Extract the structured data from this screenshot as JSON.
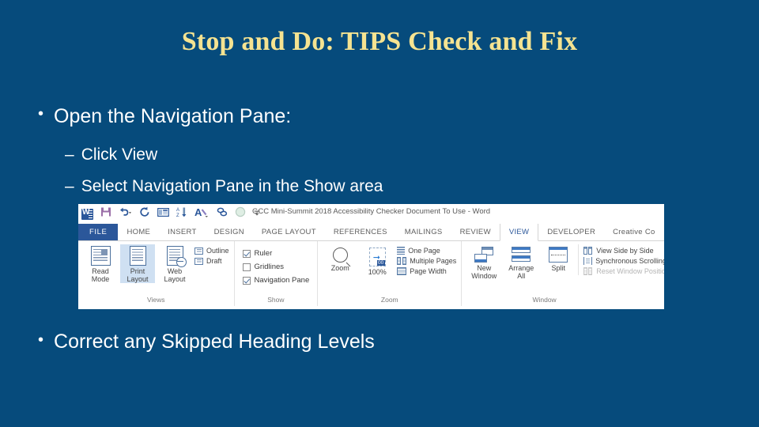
{
  "slide": {
    "title": "Stop and Do: TIPS Check and Fix",
    "bullet_1": "Open the Navigation Pane:",
    "sub_bullets": [
      "Click View",
      "Select Navigation Pane in the Show area"
    ],
    "bullet_2": "Correct any Skipped Heading Levels",
    "bullet_char": "•",
    "dash_char": "–",
    "colors": {
      "background": "#064b7c",
      "title": "#f5e391",
      "body_text": "#ffffff"
    }
  },
  "word_window": {
    "document_title": "GCC Mini-Summit 2018 Accessibility Checker Document To Use - Word",
    "quick_access": [
      {
        "name": "word-app-icon",
        "label": "W"
      },
      {
        "name": "save-icon",
        "label": "Save"
      },
      {
        "name": "undo-icon",
        "label": "Undo"
      },
      {
        "name": "redo-icon",
        "label": "Redo"
      },
      {
        "name": "table-icon",
        "label": "Insert Table"
      },
      {
        "name": "sort-icon",
        "label": "Sort"
      },
      {
        "name": "format-painter-icon",
        "label": "Styles"
      },
      {
        "name": "link-icon",
        "label": "Hyperlink"
      },
      {
        "name": "shape-icon",
        "label": "Shape"
      },
      {
        "name": "customize-qat-icon",
        "label": "Customize Quick Access Toolbar"
      }
    ],
    "tabs": [
      {
        "label": "FILE",
        "active": false,
        "file": true
      },
      {
        "label": "HOME",
        "active": false
      },
      {
        "label": "INSERT",
        "active": false
      },
      {
        "label": "DESIGN",
        "active": false
      },
      {
        "label": "PAGE LAYOUT",
        "active": false
      },
      {
        "label": "REFERENCES",
        "active": false
      },
      {
        "label": "MAILINGS",
        "active": false
      },
      {
        "label": "REVIEW",
        "active": false
      },
      {
        "label": "VIEW",
        "active": true
      },
      {
        "label": "DEVELOPER",
        "active": false
      },
      {
        "label": "Creative Co",
        "active": false
      }
    ],
    "groups": {
      "views": {
        "label": "Views",
        "buttons": [
          {
            "line1": "Read",
            "line2": "Mode",
            "selected": false
          },
          {
            "line1": "Print",
            "line2": "Layout",
            "selected": true
          },
          {
            "line1": "Web",
            "line2": "Layout",
            "selected": false
          }
        ],
        "small_buttons": [
          {
            "label": "Outline",
            "disabled": false
          },
          {
            "label": "Draft",
            "disabled": false
          }
        ]
      },
      "show": {
        "label": "Show",
        "checkboxes": [
          {
            "label": "Ruler",
            "checked": true
          },
          {
            "label": "Gridlines",
            "checked": false
          },
          {
            "label": "Navigation Pane",
            "checked": true
          }
        ]
      },
      "zoom": {
        "label": "Zoom",
        "buttons": [
          {
            "line1": "Zoom",
            "line2": ""
          },
          {
            "line1": "100%",
            "line2": ""
          }
        ],
        "small_buttons": [
          {
            "label": "One Page"
          },
          {
            "label": "Multiple Pages"
          },
          {
            "label": "Page Width"
          }
        ]
      },
      "window": {
        "label": "Window",
        "buttons": [
          {
            "line1": "New",
            "line2": "Window"
          },
          {
            "line1": "Arrange",
            "line2": "All"
          },
          {
            "line1": "Split",
            "line2": ""
          }
        ],
        "small_buttons": [
          {
            "label": "View Side by Side",
            "disabled": false
          },
          {
            "label": "Synchronous Scrolling",
            "disabled": false
          },
          {
            "label": "Reset Window Position",
            "disabled": true
          }
        ]
      }
    }
  }
}
